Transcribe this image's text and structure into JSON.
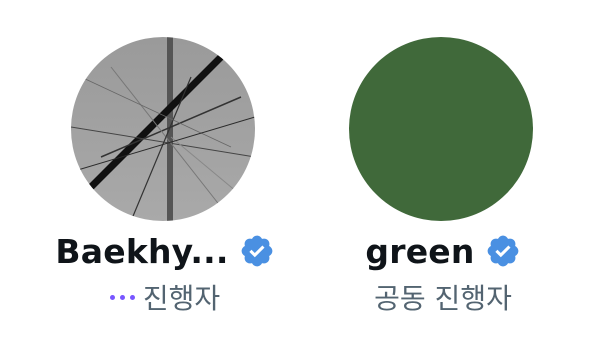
{
  "hosts": [
    {
      "name": "Baekhy...",
      "verified": true,
      "role": "진행자",
      "speaking": true,
      "avatar": {
        "style": "abstract-lines",
        "colors": [
          "#9a9a9a",
          "#1a1a1a"
        ]
      }
    },
    {
      "name": "green",
      "verified": true,
      "role": "공동 진행자",
      "speaking": false,
      "avatar": {
        "style": "solid",
        "colors": [
          "#40693a"
        ]
      }
    }
  ],
  "colors": {
    "verified_badge": "#4a90e2",
    "speaking_dots": "#7856ff",
    "name_text": "#0f1419",
    "role_text": "#536471"
  },
  "icons": {
    "verified": "verified-badge-icon",
    "speaking": "speaking-dots-icon"
  }
}
